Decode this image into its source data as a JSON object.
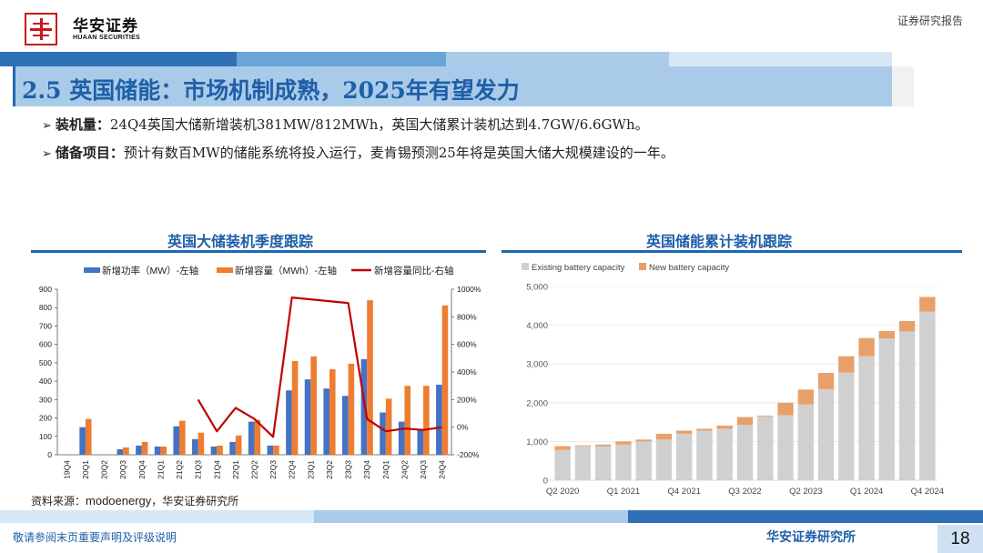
{
  "header": {
    "logo_cn": "华安证券",
    "logo_en": "HUAAN SECURITIES",
    "report_tag": "证券研究报告"
  },
  "title": "2.5 英国储能：市场机制成熟，2025年有望发力",
  "bullets": [
    {
      "label": "装机量：",
      "text": "24Q4英国大储新增装机381MW/812MWh，英国大储累计装机达到4.7GW/6.6GWh。"
    },
    {
      "label": "储备项目：",
      "text": "预计有数百MW的储能系统将投入运行，麦肯锡预测25年将是英国大储大规模建设的一年。"
    }
  ],
  "chart_titles": {
    "left": "英国大储装机季度跟踪",
    "right": "英国储能累计装机跟踪"
  },
  "source": {
    "prefix": "资料来源：",
    "org": "modoenergy",
    "suffix": "，华安证券研究所"
  },
  "footer": {
    "left": "敬请参阅末页重要声明及评级说明",
    "right": "华安证券研究所",
    "page": "18"
  },
  "colors": {
    "brand_red": "#c8161d",
    "brand_blue": "#1f5fa8",
    "power_bar": "#4472c4",
    "capacity_bar": "#ed7d31",
    "yoy_line": "#c00000",
    "existing": "#d0d0d0",
    "new": "#e8a06a"
  },
  "chart_data": [
    {
      "type": "bar",
      "title": "",
      "categories": [
        "19Q4",
        "20Q1",
        "20Q2",
        "20Q3",
        "20Q4",
        "21Q1",
        "21Q2",
        "21Q3",
        "21Q4",
        "22Q1",
        "22Q2",
        "22Q3",
        "22Q4",
        "23Q1",
        "23Q2",
        "23Q3",
        "23Q4",
        "24Q1",
        "24Q2",
        "24Q3",
        "24Q4"
      ],
      "series": [
        {
          "name": "新增功率（MW）-左轴",
          "kind": "bar",
          "axis": "left",
          "values": [
            0,
            150,
            0,
            30,
            50,
            45,
            155,
            85,
            45,
            70,
            180,
            50,
            350,
            410,
            360,
            320,
            520,
            230,
            180,
            140,
            381
          ]
        },
        {
          "name": "新增容量（MWh）-左轴",
          "kind": "bar",
          "axis": "left",
          "values": [
            0,
            195,
            0,
            40,
            70,
            45,
            185,
            120,
            50,
            105,
            190,
            50,
            510,
            535,
            465,
            495,
            840,
            305,
            375,
            375,
            812
          ]
        },
        {
          "name": "新增容量同比-右轴",
          "kind": "line",
          "axis": "right",
          "values": [
            null,
            null,
            null,
            null,
            null,
            null,
            null,
            200,
            -30,
            140,
            60,
            -70,
            940,
            null,
            null,
            900,
            60,
            -30,
            -10,
            -20,
            0
          ]
        }
      ],
      "ylim_left": [
        0,
        900
      ],
      "yticks_left": [
        0,
        100,
        200,
        300,
        400,
        500,
        600,
        700,
        800,
        900
      ],
      "ylim_right": [
        -200,
        1000
      ],
      "yticks_right": [
        "-200%",
        "0%",
        "200%",
        "400%",
        "600%",
        "800%",
        "1000%"
      ],
      "legend_position": "top",
      "grid": false
    },
    {
      "type": "bar",
      "stacked": true,
      "title": "",
      "x_tick_labels": [
        "Q2 2020",
        "Q1 2021",
        "Q4 2021",
        "Q3 2022",
        "Q2 2023",
        "Q1 2024",
        "Q4 2024"
      ],
      "categories_count": 19,
      "series": [
        {
          "name": "Existing battery capacity",
          "values": [
            780,
            880,
            880,
            920,
            1000,
            1050,
            1200,
            1280,
            1330,
            1430,
            1650,
            1680,
            1960,
            2350,
            2780,
            3200,
            3660,
            3840,
            4350
          ]
        },
        {
          "name": "New battery capacity",
          "values": [
            100,
            20,
            40,
            80,
            50,
            150,
            80,
            50,
            80,
            200,
            20,
            320,
            380,
            420,
            420,
            470,
            190,
            270,
            380
          ]
        }
      ],
      "ylim": [
        0,
        5000
      ],
      "yticks": [
        "0",
        "1,000",
        "2,000",
        "3,000",
        "4,000",
        "5,000"
      ],
      "legend_position": "top-left",
      "grid": true
    }
  ]
}
